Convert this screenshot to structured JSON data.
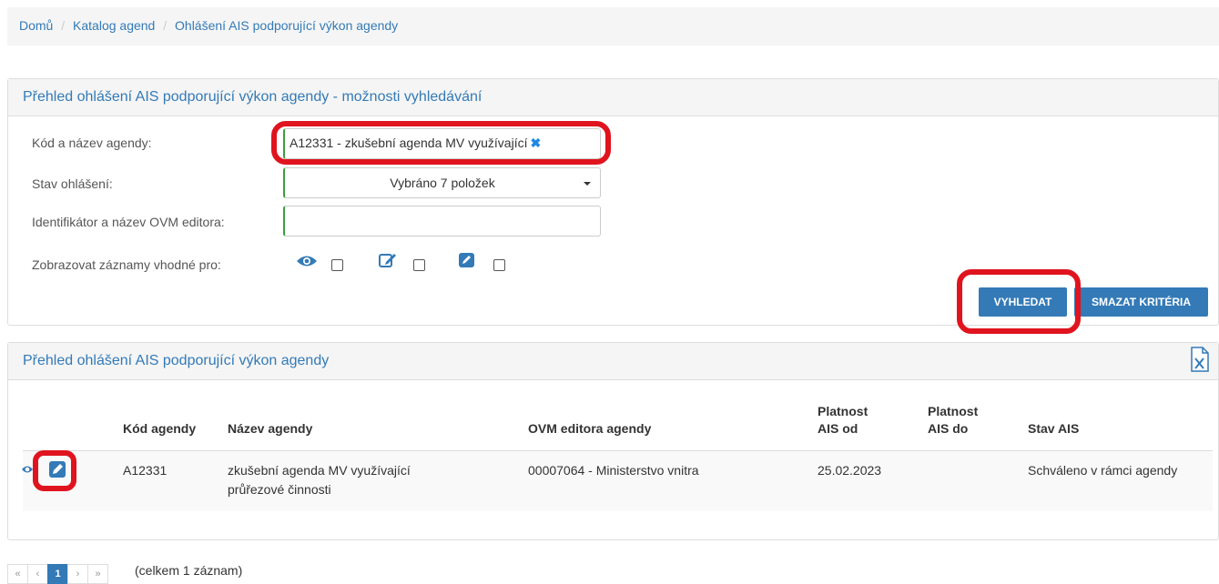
{
  "breadcrumb": {
    "items": [
      "Domů",
      "Katalog agend",
      "Ohlášení AIS podporující výkon agendy"
    ],
    "separator": "/"
  },
  "search": {
    "title": "Přehled ohlášení AIS podporující výkon agendy - možnosti vyhledávání",
    "agenda_label": "Kód a název agendy:",
    "agenda_tag": "A12331 - zkušební agenda MV využívající",
    "agenda_tag_remove": "✖",
    "state_label": "Stav ohlášení:",
    "state_value": "Vybráno 7 položek",
    "editor_label": "Identifikátor a název OVM editora:",
    "editor_value": "",
    "show_label": "Zobrazovat záznamy vhodné pro:",
    "search_button": "VYHLEDAT",
    "clear_button": "SMAZAT KRITÉRIA"
  },
  "results": {
    "title": "Přehled ohlášení AIS podporující výkon agendy",
    "columns": {
      "code": "Kód agendy",
      "name": "Název agendy",
      "ovm": "OVM editora agendy",
      "from_1": "Platnost",
      "from_2": "AIS od",
      "to_1": "Platnost",
      "to_2": "AIS do",
      "state": "Stav AIS"
    },
    "rows": [
      {
        "code": "A12331",
        "name_1": "zkušební agenda MV využívající",
        "name_2": "průřezové činnosti",
        "ovm": "00007064 - Ministerstvo vnitra",
        "from": "25.02.2023",
        "to": "",
        "state": "Schváleno v rámci agendy"
      }
    ]
  },
  "pagination": {
    "first": "«",
    "prev": "‹",
    "current": "1",
    "next": "›",
    "last": "»",
    "summary": "(celkem 1 záznam)"
  },
  "colors": {
    "link": "#337ab7",
    "highlight": "#e0141e",
    "valid_border": "#3c9e3c"
  }
}
